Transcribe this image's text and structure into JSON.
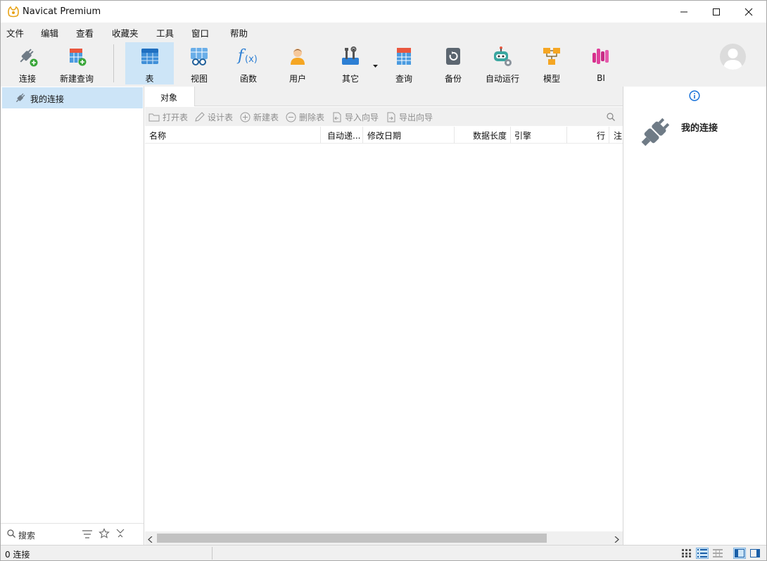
{
  "window": {
    "title": "Navicat Premium"
  },
  "menu": [
    "文件",
    "编辑",
    "查看",
    "收藏夹",
    "工具",
    "窗口",
    "帮助"
  ],
  "toolbar": {
    "connect": "连接",
    "new_query": "新建查询",
    "table": "表",
    "view": "视图",
    "function": "函数",
    "user": "用户",
    "other": "其它",
    "query": "查询",
    "backup": "备份",
    "automation": "自动运行",
    "model": "模型",
    "bi": "BI"
  },
  "sidebar": {
    "items": [
      {
        "label": "我的连接"
      }
    ],
    "search_placeholder": "搜索"
  },
  "tabs": [
    {
      "label": "对象"
    }
  ],
  "object_toolbar": {
    "open_table": "打开表",
    "design_table": "设计表",
    "new_table": "新建表",
    "delete_table": "删除表",
    "import_wizard": "导入向导",
    "export_wizard": "导出向导"
  },
  "columns": [
    "名称",
    "自动递...",
    "修改日期",
    "数据长度",
    "引擎",
    "行",
    "注"
  ],
  "right_panel": {
    "title": "我的连接"
  },
  "status": {
    "connections": "0 连接"
  },
  "colors": {
    "accent": "#0078d7",
    "selection": "#cce4f7",
    "active_tool": "#cde5f7"
  }
}
